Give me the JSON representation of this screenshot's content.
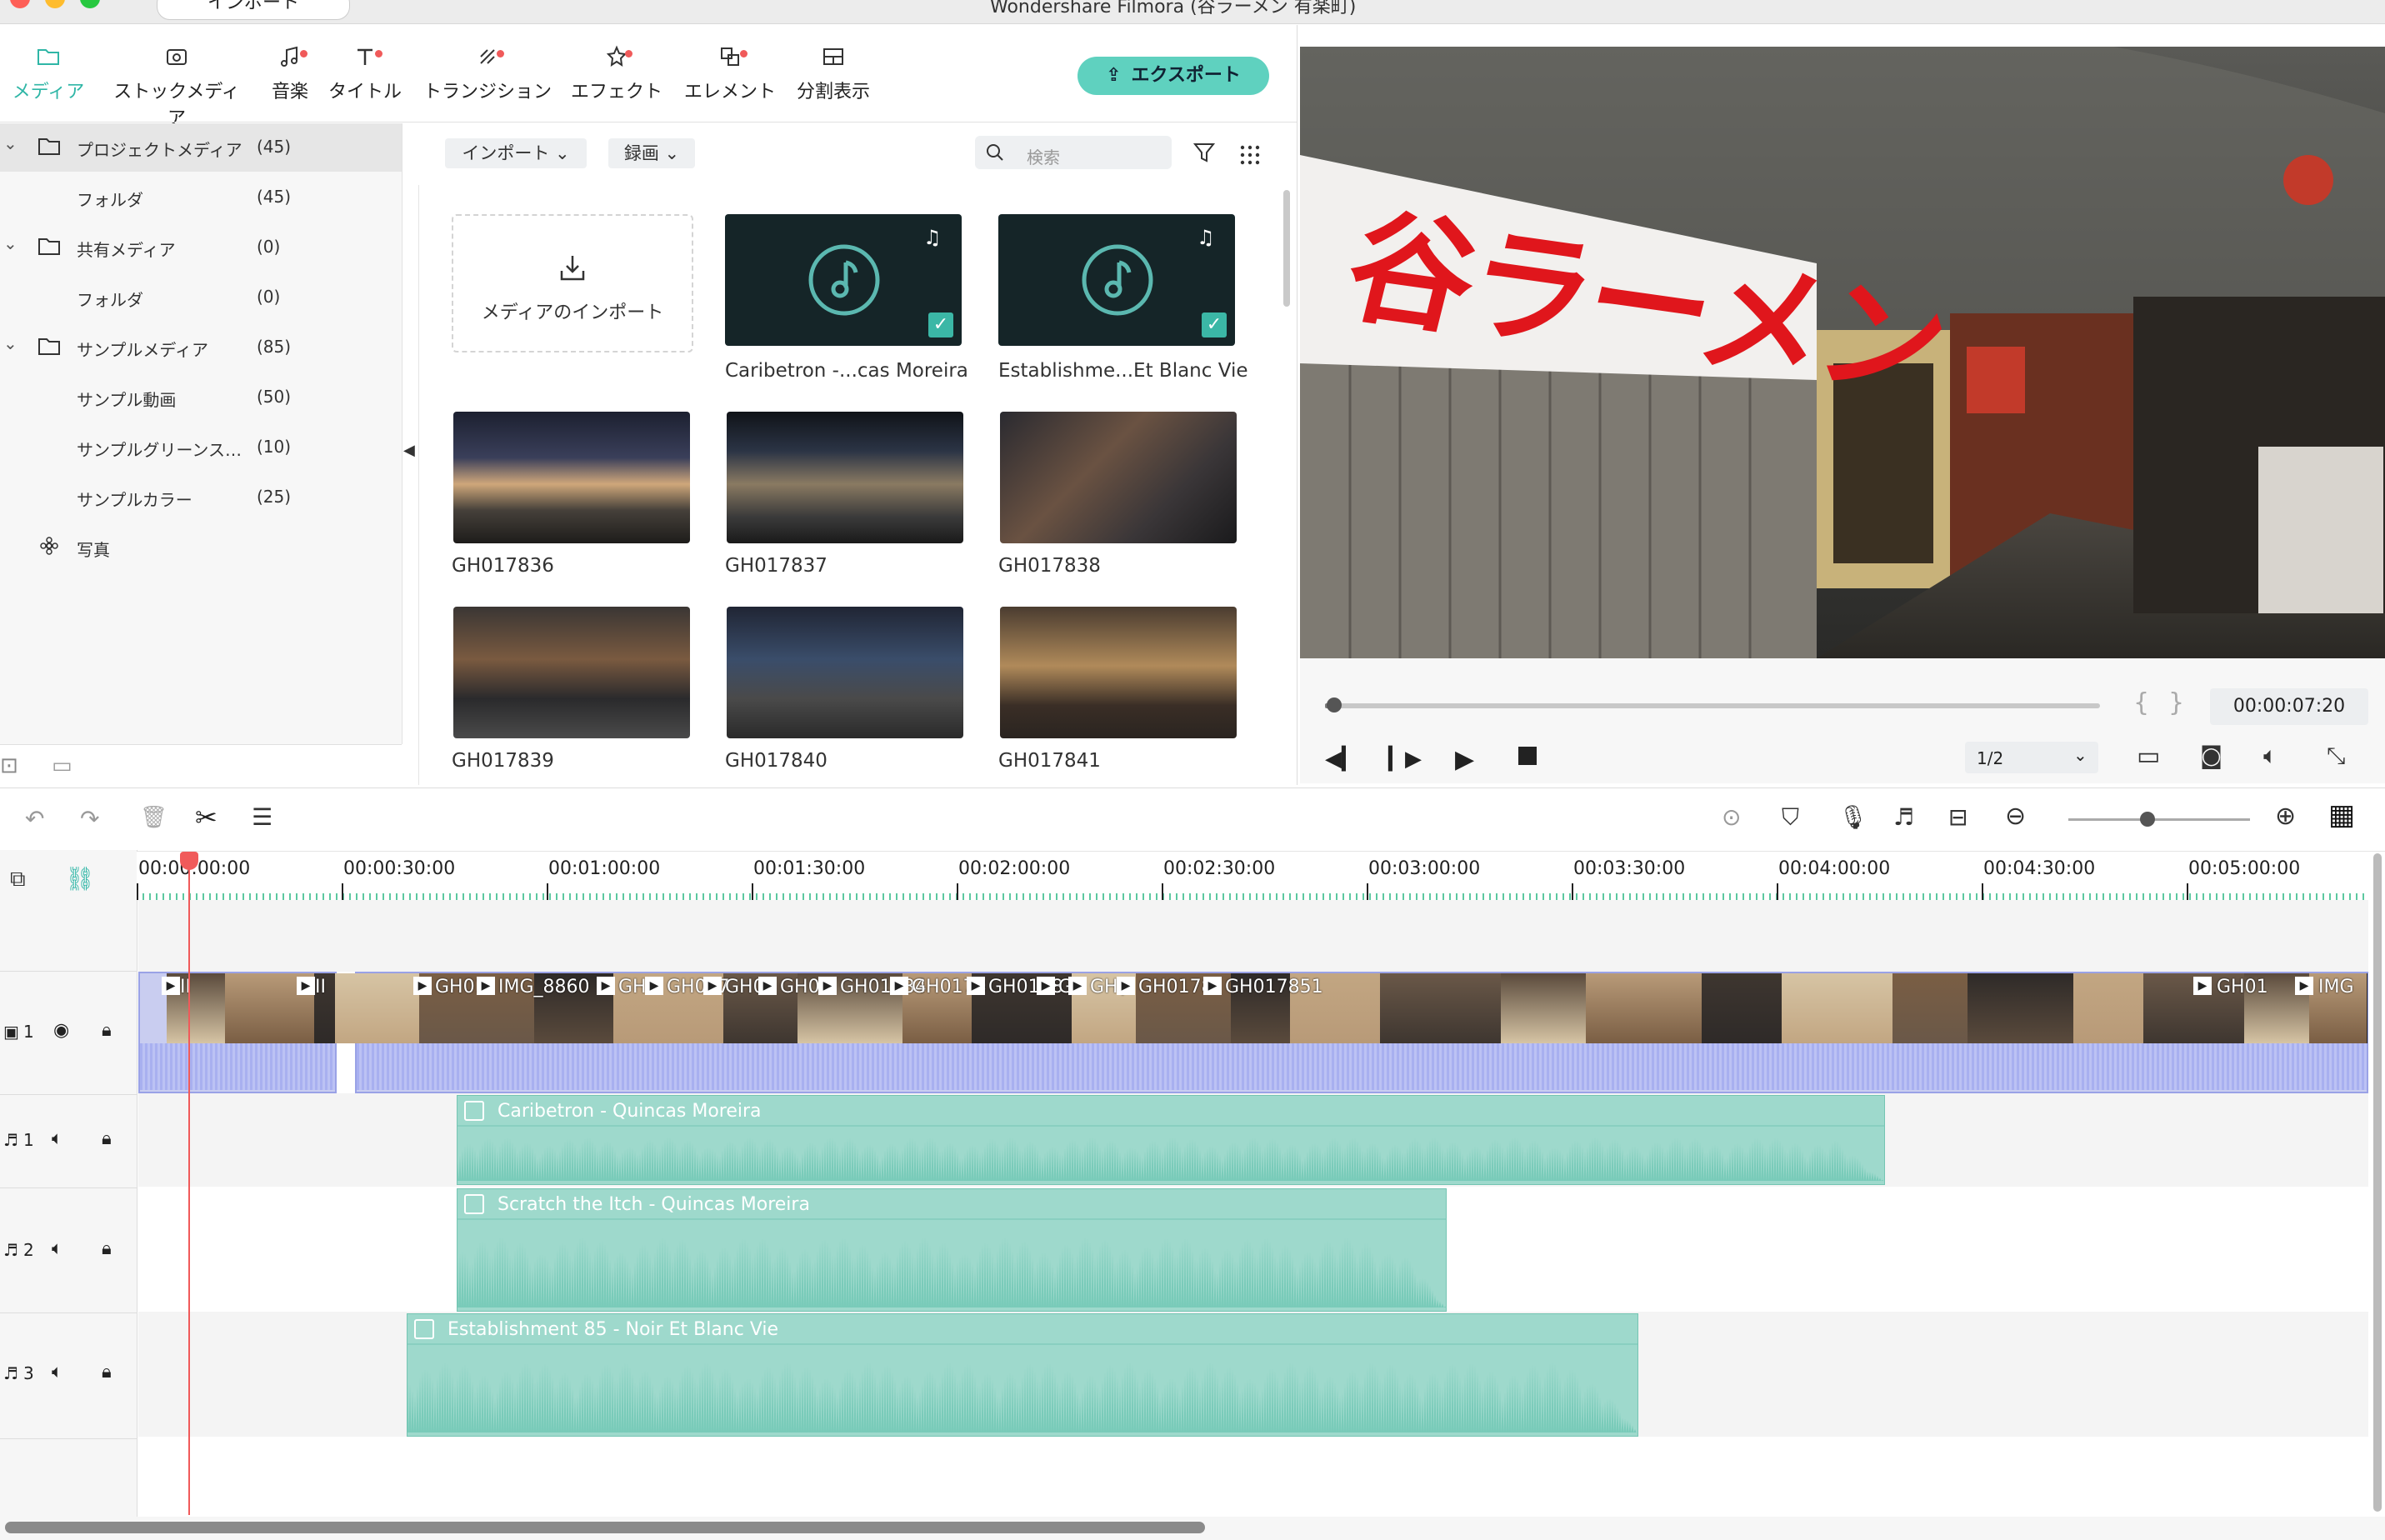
{
  "window": {
    "title": "Wondershare Filmora (谷ラーメン 有楽町)",
    "import_tab": "インポート"
  },
  "toolbar": {
    "items": [
      {
        "label": "メディア",
        "icon": "folder-icon"
      },
      {
        "label": "ストックメディア",
        "icon": "cloud-icon"
      },
      {
        "label": "音楽",
        "icon": "music-note-icon"
      },
      {
        "label": "タイトル",
        "icon": "title-icon"
      },
      {
        "label": "トランジション",
        "icon": "transition-icon"
      },
      {
        "label": "エフェクト",
        "icon": "effect-icon"
      },
      {
        "label": "エレメント",
        "icon": "element-icon"
      },
      {
        "label": "分割表示",
        "icon": "split-screen-icon"
      }
    ],
    "export_label": "エクスポート",
    "accent": "#2fb6a6"
  },
  "tree": {
    "items": [
      {
        "label": "プロジェクトメディア",
        "count": "(45)"
      },
      {
        "label": "フォルダ",
        "count": "(45)"
      },
      {
        "label": "共有メディア",
        "count": "(0)"
      },
      {
        "label": "フォルダ",
        "count": "(0)"
      },
      {
        "label": "サンプルメディア",
        "count": "(85)"
      },
      {
        "label": "サンプル動画",
        "count": "(50)"
      },
      {
        "label": "サンプルグリーンス…",
        "count": "(10)"
      },
      {
        "label": "サンプルカラー",
        "count": "(25)"
      },
      {
        "label": "写真",
        "count": ""
      }
    ]
  },
  "media": {
    "import_dropdown": "インポート",
    "record_dropdown": "録画",
    "search_placeholder": "検索",
    "import_tile_label": "メディアのインポート",
    "items": [
      {
        "name": "Caribetron -...cas Moreira",
        "kind": "audio"
      },
      {
        "name": "Establishme...Et Blanc Vie",
        "kind": "audio"
      },
      {
        "name": "GH017836",
        "kind": "video"
      },
      {
        "name": "GH017837",
        "kind": "video"
      },
      {
        "name": "GH017838",
        "kind": "video"
      },
      {
        "name": "GH017839",
        "kind": "video"
      },
      {
        "name": "GH017840",
        "kind": "video"
      },
      {
        "name": "GH017841",
        "kind": "video"
      }
    ]
  },
  "preview": {
    "sign_text": "谷ラーメン",
    "timecode": "00:00:07:20",
    "quality": "1/2",
    "progress": 0.004
  },
  "timeline": {
    "ruler": [
      "00:00:00:00",
      "00:00:30:00",
      "00:01:00:00",
      "00:01:30:00",
      "00:02:00:00",
      "00:02:30:00",
      "00:03:00:00",
      "00:03:30:00",
      "00:04:00:00",
      "00:04:30:00",
      "00:05:00:00"
    ],
    "tracks": [
      {
        "label": "1",
        "type": "video"
      },
      {
        "label": "1",
        "type": "audio"
      },
      {
        "label": "2",
        "type": "audio"
      },
      {
        "label": "3",
        "type": "audio"
      }
    ],
    "video_clips": [
      "II",
      "II",
      "GH01",
      "IMG_8860",
      "GH",
      "GH017",
      "GH0",
      "GH0",
      "GH01784",
      "GH0178",
      "GH0178",
      "GH",
      "GH(",
      "GH0178",
      "GH017851",
      "GH01",
      "IMG"
    ],
    "audio_clips": [
      {
        "label": "Caribetron - Quincas Moreira"
      },
      {
        "label": "Scratch the Itch - Quincas Moreira"
      },
      {
        "label": "Establishment 85 - Noir Et Blanc Vie"
      }
    ]
  }
}
